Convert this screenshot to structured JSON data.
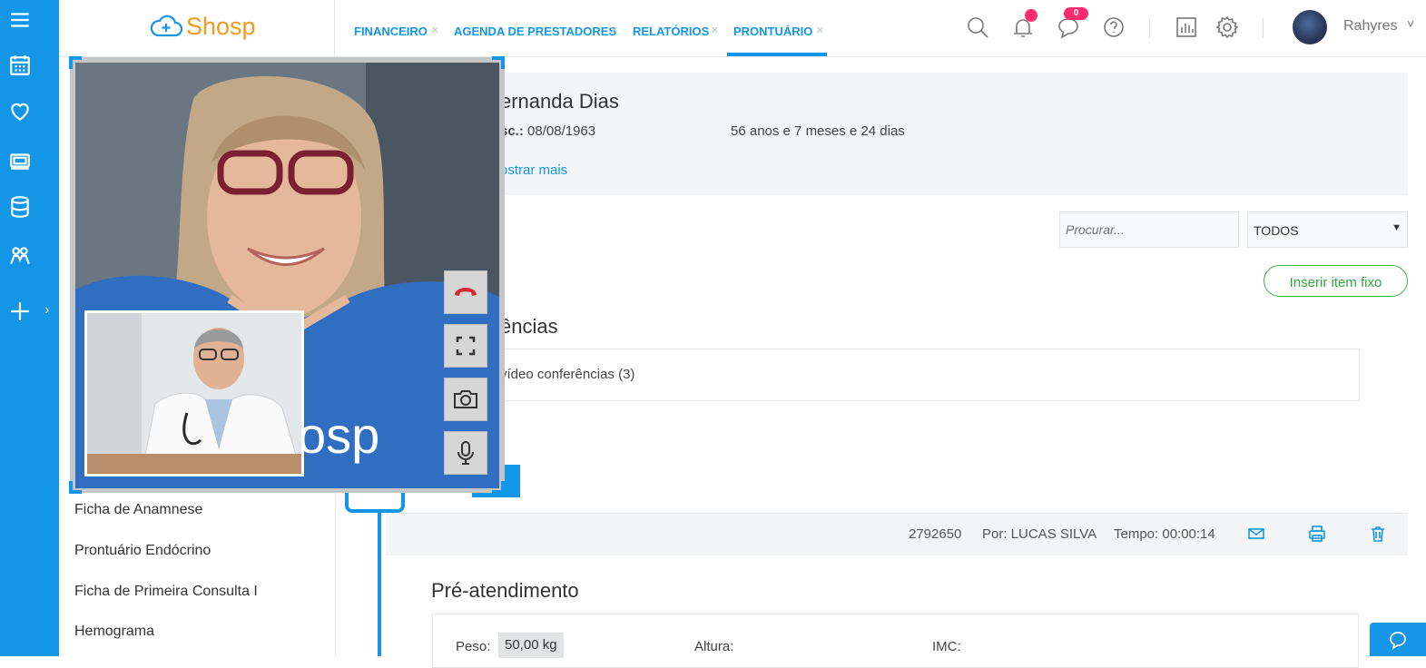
{
  "app": {
    "logo_text": "Shosp"
  },
  "tabs": [
    {
      "label": "FINANCEIRO"
    },
    {
      "label": "AGENDA DE PRESTADORES"
    },
    {
      "label": "RELATÓRIOS"
    },
    {
      "label": "PRONTUÁRIO",
      "active": true
    }
  ],
  "tab_close_glyph": "×",
  "header": {
    "messages_badge": "0",
    "username": "Rahyres",
    "user_caret": "˅",
    "icons": [
      "search-icon",
      "bell-icon",
      "chat-icon",
      "help-icon",
      "chart-icon",
      "gear-icon"
    ]
  },
  "rail": {
    "icons": [
      "menu-icon",
      "calendar-icon",
      "heart-icon",
      "money-icon",
      "database-icon",
      "people-icon",
      "plus-icon"
    ],
    "expand_glyph": "›"
  },
  "patient": {
    "name_visible": "ernanda Dias",
    "dob_label": "sc.:",
    "dob_value": "08/08/1963",
    "age": "56 anos e 7 meses e 24 dias",
    "show_more": "ostrar mais"
  },
  "filters": {
    "search_placeholder": "Procurar...",
    "select_value": "TODOS",
    "select_caret": "▼",
    "insert_fixed_label": "Inserir item fixo"
  },
  "conferences": {
    "title_visible": "ências",
    "summary_visible": "vídeo conferências (3)"
  },
  "templates": {
    "items": [
      {
        "label": "Ficha de Anamnese"
      },
      {
        "label": "Prontuário Endócrino"
      },
      {
        "label": "Ficha de Primeira Consulta I"
      },
      {
        "label": "Hemograma"
      }
    ]
  },
  "record": {
    "id": "2792650",
    "by": "Por: LUCAS SILVA",
    "time": "Tempo: 00:00:14",
    "actions": [
      "mail-icon",
      "print-icon",
      "trash-icon"
    ]
  },
  "pre_attendance": {
    "title": "Pré-atendimento",
    "weight_label": "Peso:",
    "weight_value": "50,00 kg",
    "height_label": "Altura:",
    "bmi_label": "IMC:"
  },
  "video_call": {
    "remote_shirt_text": "osp",
    "controls": [
      "hangup-icon",
      "fullscreen-icon",
      "camera-icon",
      "microphone-icon"
    ],
    "colors": {
      "hangup": "#d8282b",
      "accent": "#1496e8"
    }
  },
  "colors": {
    "primary": "#1496e8",
    "success": "#3bb54a",
    "brand_orange": "#f39a1e",
    "badge": "#ff2d6d"
  }
}
